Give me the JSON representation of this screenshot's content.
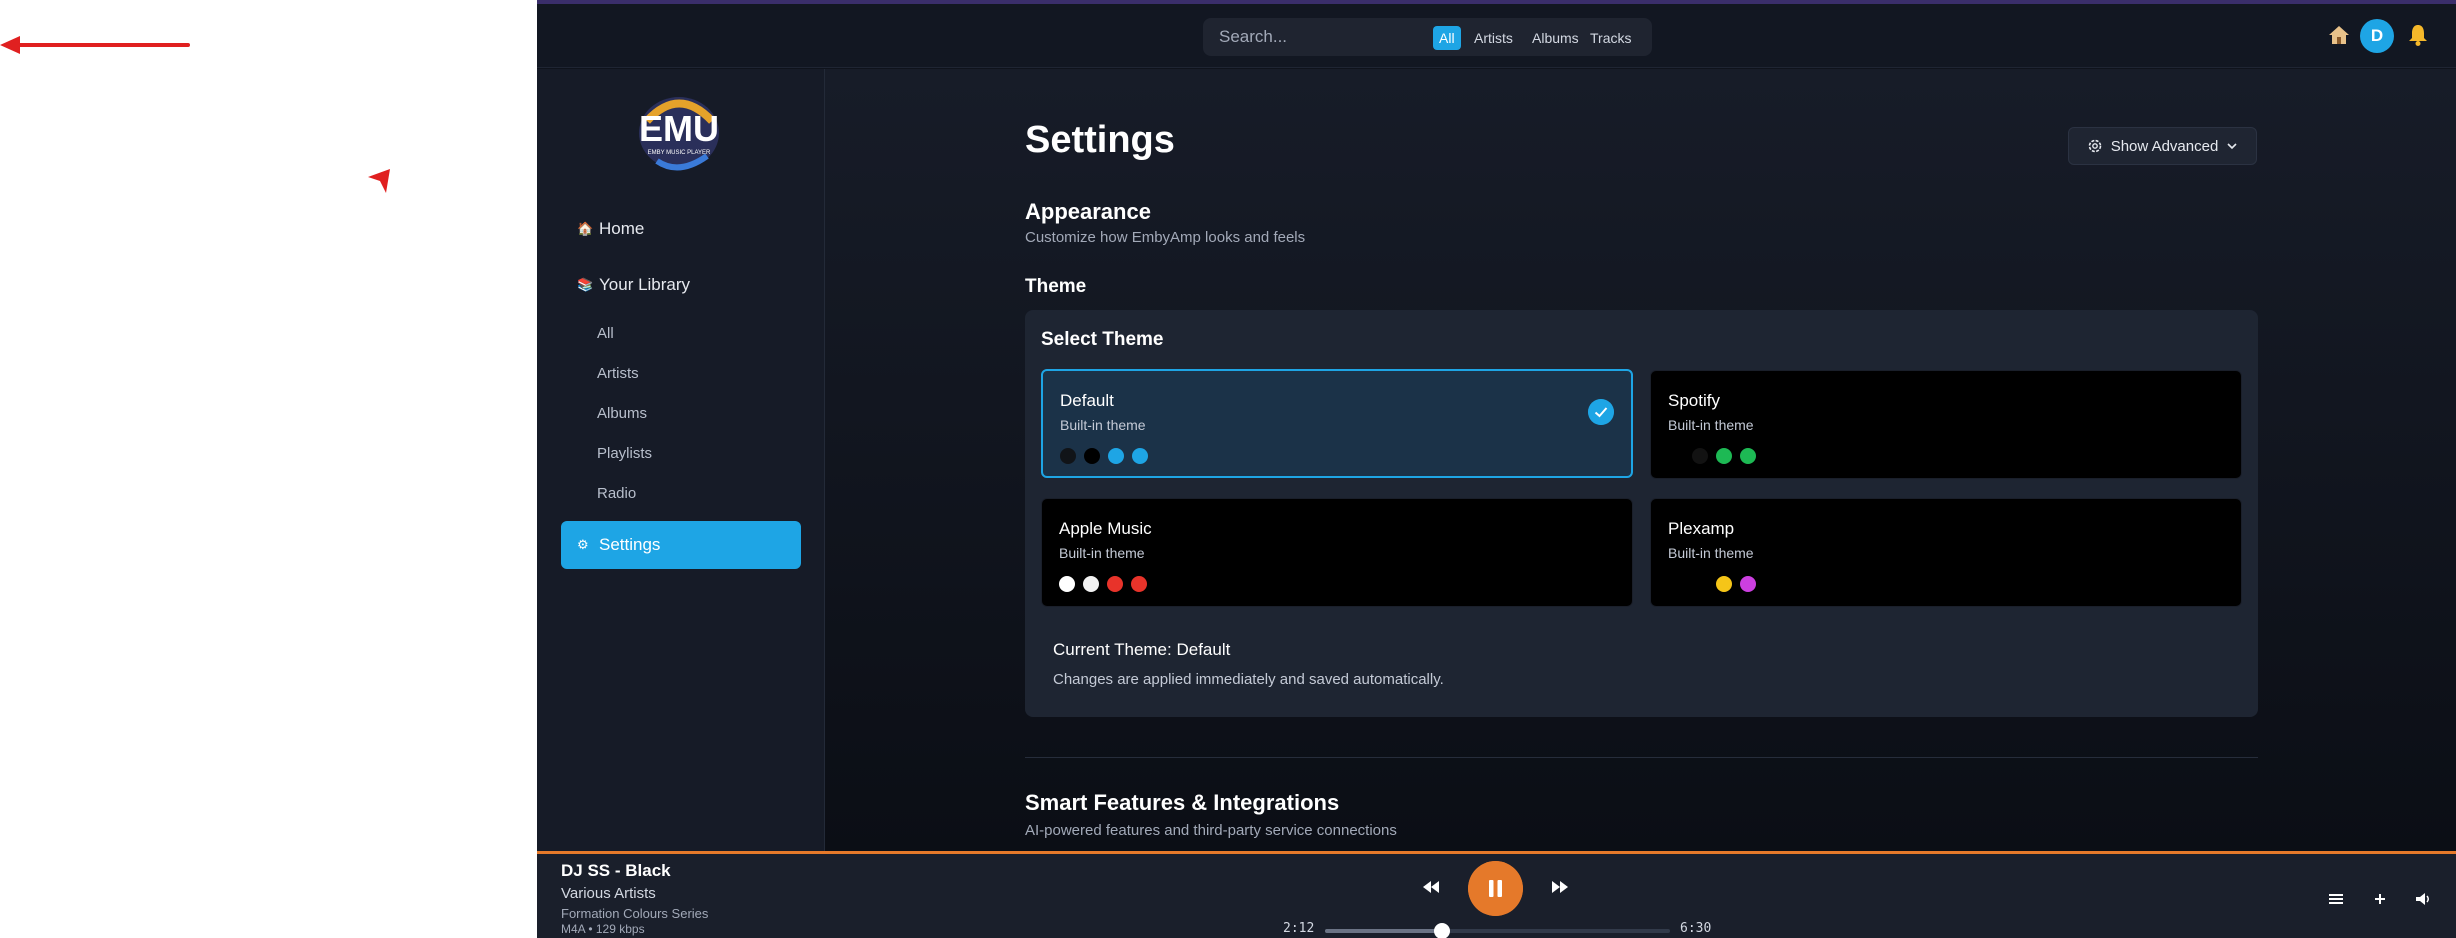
{
  "header": {
    "search_placeholder": "Search...",
    "filters": [
      "All",
      "Artists",
      "Albums",
      "Tracks"
    ],
    "active_filter": "All",
    "avatar_letter": "D"
  },
  "sidebar": {
    "logo_text": "EMU",
    "logo_subtext": "EMBY MUSIC PLAYER",
    "home": "Home",
    "library": "Your Library",
    "sub_items": [
      "All",
      "Artists",
      "Albums",
      "Playlists",
      "Radio"
    ],
    "settings": "Settings"
  },
  "main": {
    "title": "Settings",
    "advanced_button": "Show Advanced",
    "appearance_title": "Appearance",
    "appearance_desc": "Customize how EmbyAmp looks and feels",
    "theme_title": "Theme",
    "panel_title": "Select Theme",
    "themes": [
      {
        "name": "Default",
        "sub": "Built-in theme",
        "colors": [
          "#111418",
          "#000000",
          "#1ea5e5",
          "#1ea5e5"
        ],
        "selected": true
      },
      {
        "name": "Spotify",
        "sub": "Built-in theme",
        "colors": [
          "#000000",
          "#121212",
          "#1db954",
          "#1db954"
        ],
        "selected": false
      },
      {
        "name": "Apple Music",
        "sub": "Built-in theme",
        "colors": [
          "#ffffff",
          "#f2f2f2",
          "#e8332a",
          "#e8332a"
        ],
        "selected": false
      },
      {
        "name": "Plexamp",
        "sub": "Built-in theme",
        "colors": [
          "#000000",
          "#000000",
          "#f5c518",
          "#cc3fe0"
        ],
        "selected": false
      }
    ],
    "current_theme": "Current Theme: Default",
    "current_note": "Changes are applied immediately and saved automatically.",
    "smart_title": "Smart Features & Integrations",
    "smart_desc": "AI-powered features and third-party service connections"
  },
  "player": {
    "title": "DJ SS - Black",
    "artist": "Various Artists",
    "album": "Formation Colours Series",
    "format": "M4A • 129 kbps",
    "current_time": "2:12",
    "total_time": "6:30",
    "progress": 0.338
  },
  "colors": {
    "accent": "#1ea5e5",
    "player_accent": "#e5792a"
  }
}
